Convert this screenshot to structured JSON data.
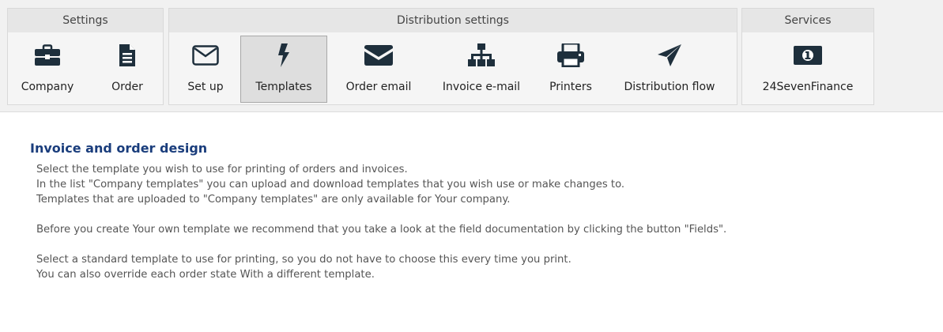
{
  "groups": {
    "settings": {
      "title": "Settings",
      "buttons": [
        "Company",
        "Order"
      ]
    },
    "distribution": {
      "title": "Distribution settings",
      "buttons": [
        "Set up",
        "Templates",
        "Order email",
        "Invoice e-mail",
        "Printers",
        "Distribution flow"
      ]
    },
    "services": {
      "title": "Services",
      "buttons": [
        "24SevenFinance"
      ]
    }
  },
  "active_button": "Templates",
  "icons": {
    "company": "briefcase-icon",
    "order": "document-icon",
    "setup": "envelope-outline-icon",
    "templates": "lightning-icon",
    "order_email": "envelope-icon",
    "invoice_email": "sitemap-icon",
    "printers": "printer-icon",
    "distribution_flow": "paper-plane-icon",
    "finance": "money-icon"
  },
  "colors": {
    "icon": "#1e2f3c",
    "title": "#1a3d7c",
    "active_bg": "#dedede"
  },
  "content": {
    "title": "Invoice and order design",
    "paragraphs": [
      "Select the template you wish to use for printing of orders and invoices.",
      "In the list \"Company templates\" you can upload and download templates that you wish use or make changes to.",
      "Templates that are uploaded to \"Company templates\" are only available for Your company.",
      "",
      "Before you create Your own template we recommend that you take a look at the field documentation by clicking the button \"Fields\".",
      "",
      "Select a standard template to use for printing, so you do not have to choose this every time you print.",
      "You can also override each order state With a different template."
    ]
  }
}
